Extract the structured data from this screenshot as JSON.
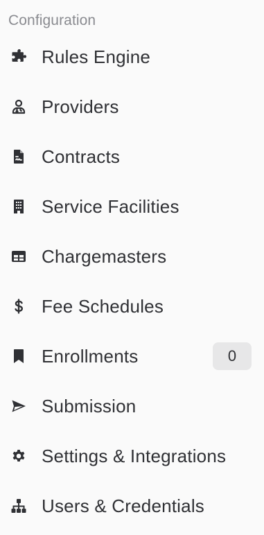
{
  "section": {
    "title": "Configuration"
  },
  "menu": {
    "items": [
      {
        "label": "Rules Engine",
        "icon": "puzzle-icon"
      },
      {
        "label": "Providers",
        "icon": "doctor-icon"
      },
      {
        "label": "Contracts",
        "icon": "contract-file-icon"
      },
      {
        "label": "Service Facilities",
        "icon": "building-icon"
      },
      {
        "label": "Chargemasters",
        "icon": "table-icon"
      },
      {
        "label": "Fee Schedules",
        "icon": "dollar-icon"
      },
      {
        "label": "Enrollments",
        "icon": "bookmark-icon",
        "badge": "0"
      },
      {
        "label": "Submission",
        "icon": "send-icon"
      },
      {
        "label": "Settings & Integrations",
        "icon": "gear-icon"
      },
      {
        "label": "Users & Credentials",
        "icon": "sitemap-icon"
      }
    ]
  }
}
